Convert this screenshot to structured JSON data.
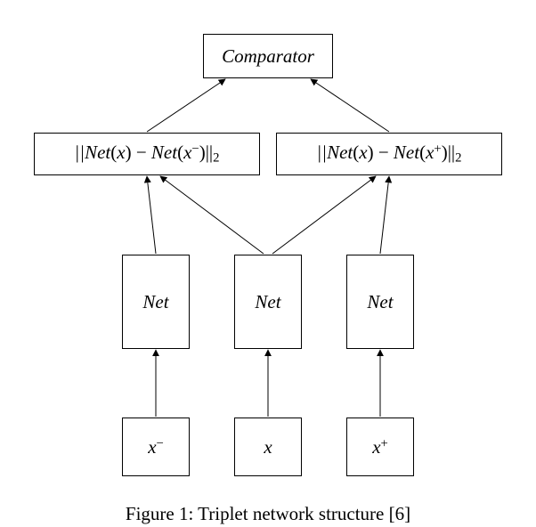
{
  "diagram": {
    "comparator": "Comparator",
    "dist_neg": "||Net(x) − Net(x⁻)||",
    "dist_neg_sub": "2",
    "dist_pos": "||Net(x) − Net(x⁺)||",
    "dist_pos_sub": "2",
    "net_left": "Net",
    "net_mid": "Net",
    "net_right": "Net",
    "input_left_base": "x",
    "input_left_sup": "−",
    "input_mid": "x",
    "input_right_base": "x",
    "input_right_sup": "+"
  },
  "caption": "Figure 1: Triplet network structure [6]"
}
